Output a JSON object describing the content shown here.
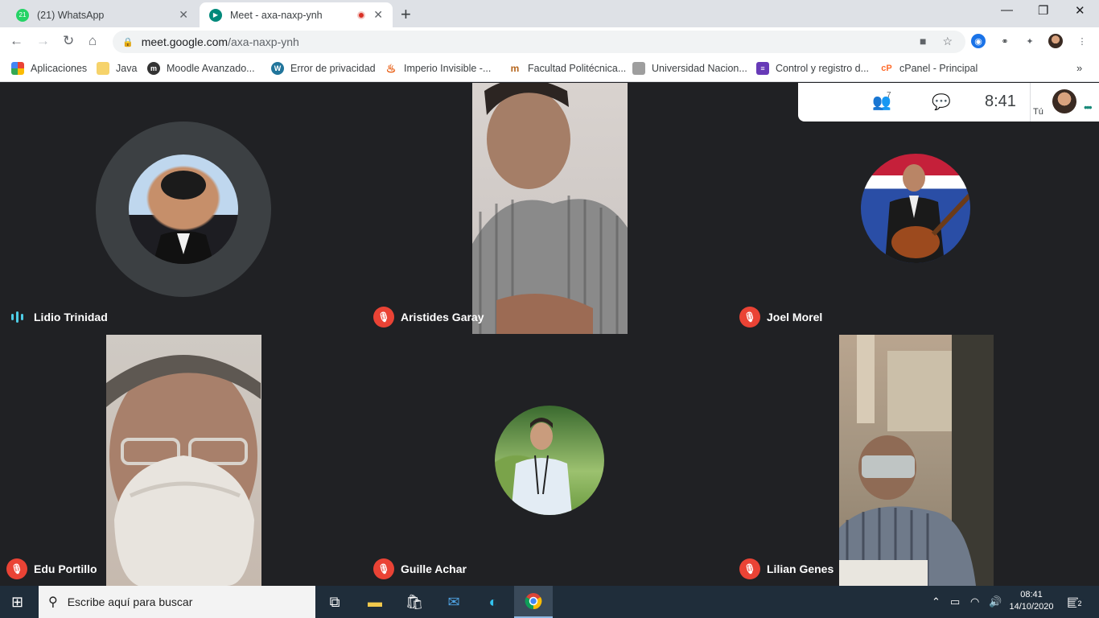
{
  "browser": {
    "tabs": [
      {
        "title": "(21) WhatsApp",
        "badge": "21",
        "active": false
      },
      {
        "title": "Meet - axa-naxp-ynh",
        "active": true,
        "recording": true
      }
    ],
    "address": {
      "host": "meet.google.com",
      "path": "/axa-naxp-ynh"
    },
    "bookmarks": [
      {
        "label": "Aplicaciones",
        "icon": "apps-grid-icon"
      },
      {
        "label": "Java",
        "icon": "folder-icon"
      },
      {
        "label": "Moodle Avanzado...",
        "icon": "moodle-icon"
      },
      {
        "label": "Error de privacidad",
        "icon": "wordpress-icon"
      },
      {
        "label": "Imperio Invisible -...",
        "icon": "flame-icon"
      },
      {
        "label": "Facultad Politécnica...",
        "icon": "fpuna-icon"
      },
      {
        "label": "Universidad Nacion...",
        "icon": "university-icon"
      },
      {
        "label": "Control y registro d...",
        "icon": "form-icon"
      },
      {
        "label": "cPanel - Principal",
        "icon": "cpanel-icon"
      }
    ]
  },
  "meet": {
    "participants_count": "7",
    "clock": "8:41",
    "self_label": "Tú",
    "participants": [
      {
        "name": "Lidio Trinidad",
        "state": "speaking"
      },
      {
        "name": "Aristides Garay",
        "state": "muted"
      },
      {
        "name": "Joel Morel",
        "state": "muted"
      },
      {
        "name": "Edu Portillo",
        "state": "muted"
      },
      {
        "name": "Guille Achar",
        "state": "muted"
      },
      {
        "name": "Lilian Genes",
        "state": "muted"
      }
    ]
  },
  "taskbar": {
    "search_placeholder": "Escribe aquí para buscar",
    "time": "08:41",
    "date": "14/10/2020",
    "notifications": "2"
  },
  "colors": {
    "meet_bg": "#202124",
    "mic_off": "#ea4335",
    "speaking": "#4ecde6",
    "taskbar": "#1f2d3a"
  }
}
